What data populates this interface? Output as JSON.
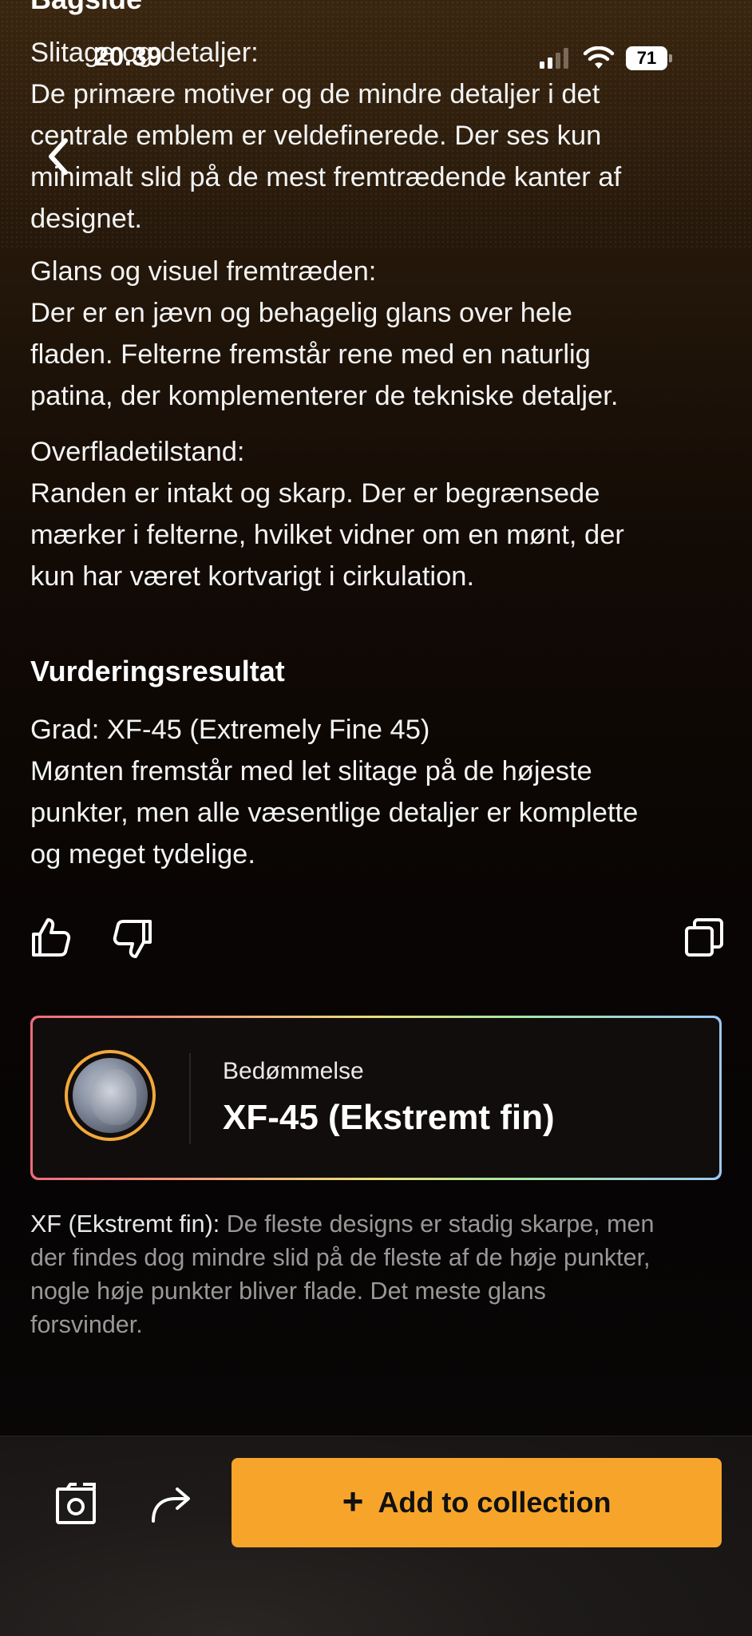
{
  "status_bar": {
    "time": "20.39",
    "battery": "71"
  },
  "partial_heading": "Bagside",
  "sections": [
    {
      "lines": [
        "Slitage og detaljer:",
        "De primære motiver og de mindre detaljer i det",
        "centrale emblem er veldefinerede. Der ses kun",
        "minimalt slid på de mest fremtrædende kanter af",
        "designet."
      ]
    },
    {
      "lines": [
        "Glans og visuel fremtræden:",
        "Der er en jævn og behagelig glans over hele",
        "fladen. Felterne fremstår rene med en naturlig",
        "patina, der komplementerer de tekniske detaljer."
      ]
    },
    {
      "lines": [
        "Overfladetilstand:",
        "Randen er intakt og skarp. Der er begrænsede",
        "mærker i felterne, hvilket vidner om en mønt, der",
        "kun har været kortvarigt i cirkulation."
      ]
    }
  ],
  "result": {
    "title": "Vurderingsresultat",
    "lines": [
      "Grad: XF-45 (Extremely Fine 45)",
      "Mønten fremstår med let slitage på de højeste",
      "punkter, men alle væsentlige detaljer er komplette",
      "og meget tydelige."
    ]
  },
  "card": {
    "label": "Bedømmelse",
    "value": "XF-45 (Ekstremt fin)"
  },
  "explanation": {
    "term": "XF (Ekstremt fin):",
    "first_line_rest": " De fleste designs er stadig skarpe, men",
    "lines": [
      "der findes dog mindre slid på de fleste af de høje punkter,",
      "nogle høje punkter bliver flade. Det meste glans",
      "forsvinder."
    ]
  },
  "bottom_bar": {
    "add_label": "Add to collection"
  },
  "colors": {
    "accent": "#f7a52a",
    "coin_ring": "#f2a93b"
  }
}
